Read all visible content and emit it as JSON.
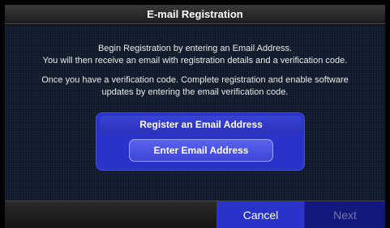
{
  "dialog": {
    "title": "E-mail Registration"
  },
  "instructions": {
    "line1": "Begin Registration by entering an Email Address.",
    "line2": "You will then receive an email with registration details and a verification code.",
    "line3": "Once you have a verification code. Complete registration and enable software",
    "line4": "updates by entering the email verification code."
  },
  "register_panel": {
    "header": "Register an Email Address",
    "enter_button": "Enter Email Address"
  },
  "footer": {
    "cancel_label": "Cancel",
    "next_label": "Next",
    "next_enabled": false
  },
  "colors": {
    "accent_blue": "#2a33c9",
    "disabled_blue": "#14187a",
    "background": "#0e1828"
  }
}
